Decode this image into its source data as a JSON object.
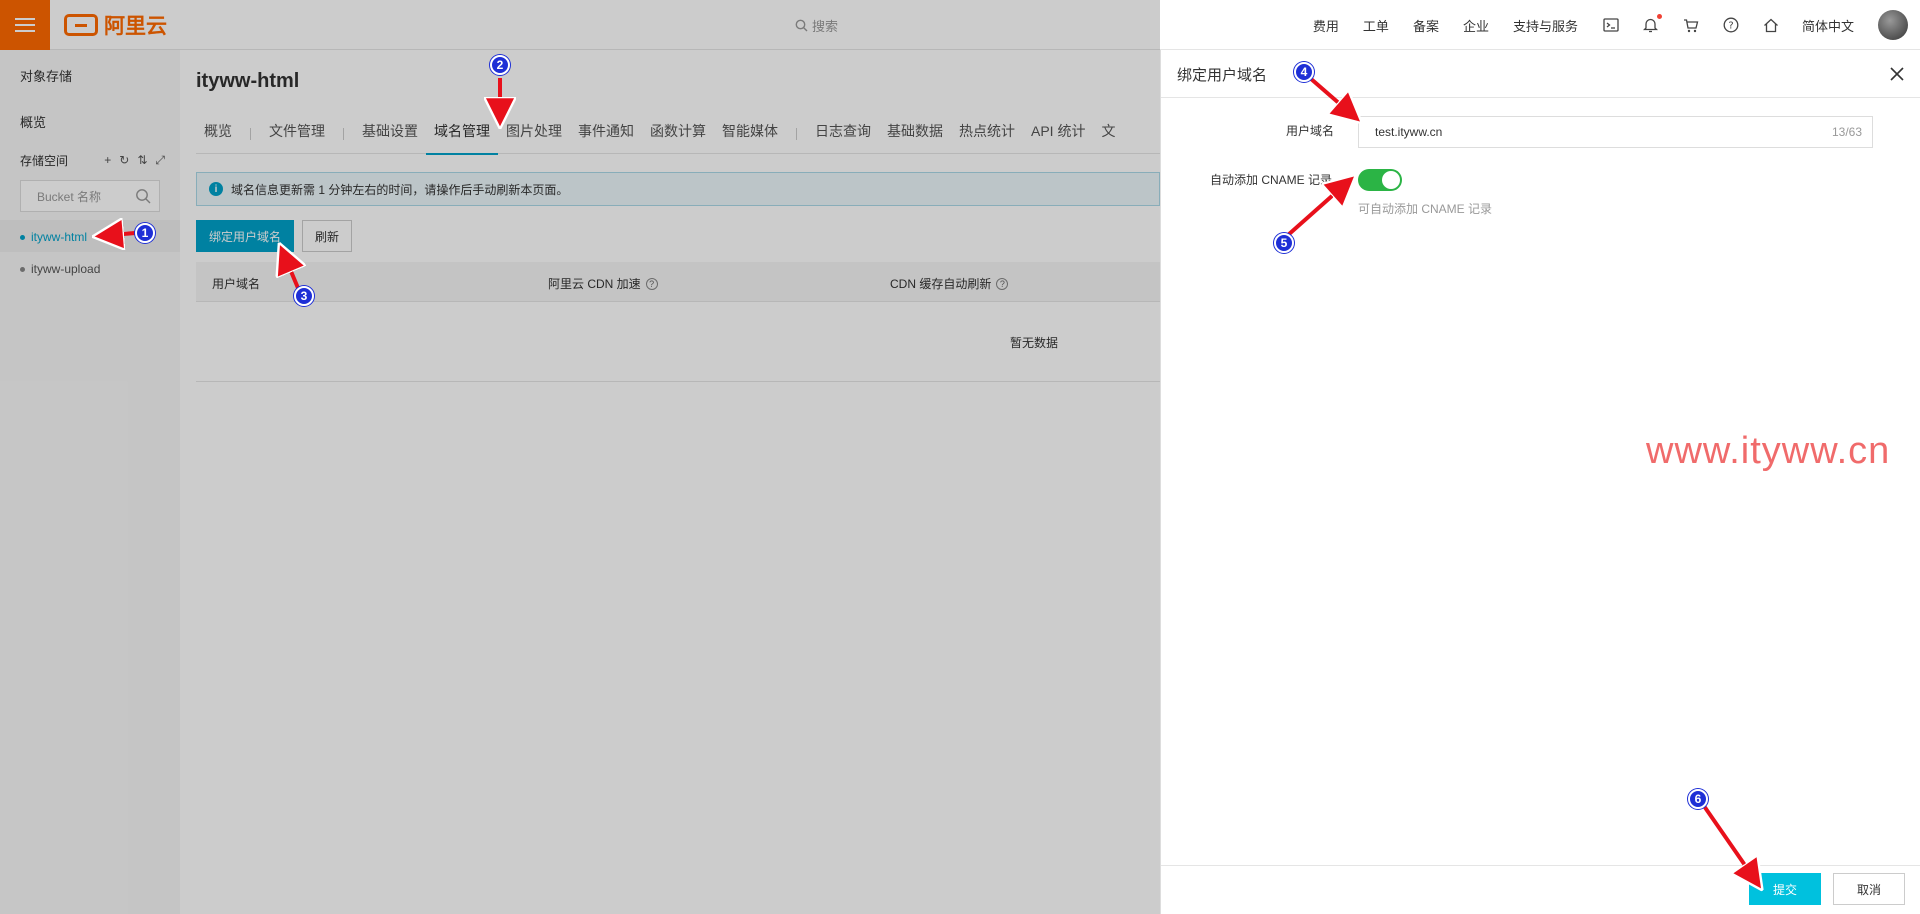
{
  "topbar": {
    "logo_text": "阿里云",
    "search_placeholder": "搜索",
    "nav": [
      "费用",
      "工单",
      "备案",
      "企业",
      "支持与服务"
    ],
    "language": "简体中文"
  },
  "sidebar": {
    "title": "对象存储",
    "overview": "概览",
    "space_header": "存储空间",
    "bucket_search_placeholder": "Bucket 名称",
    "buckets": [
      "ityww-html",
      "ityww-upload"
    ]
  },
  "main": {
    "page_title": "ityww-html",
    "tabs": [
      "概览",
      "文件管理",
      "基础设置",
      "域名管理",
      "图片处理",
      "事件通知",
      "函数计算",
      "智能媒体",
      "日志查询",
      "基础数据",
      "热点统计",
      "API 统计",
      "文"
    ],
    "active_tab": "域名管理",
    "notice": "域名信息更新需 1 分钟左右的时间，请操作后手动刷新本页面。",
    "bind_button": "绑定用户域名",
    "refresh_button": "刷新",
    "table_headers": [
      "用户域名",
      "阿里云 CDN 加速",
      "CDN 缓存自动刷新"
    ],
    "empty_text": "暂无数据"
  },
  "drawer": {
    "title": "绑定用户域名",
    "domain_label": "用户域名",
    "domain_value": "test.ityww.cn",
    "domain_count": "13/63",
    "cname_label": "自动添加 CNAME 记录",
    "cname_enabled": true,
    "cname_hint": "可自动添加 CNAME 记录",
    "submit_button": "提交",
    "cancel_button": "取消",
    "watermark": "www.ityww.cn"
  },
  "annotations": [
    "1",
    "2",
    "3",
    "4",
    "5",
    "6"
  ],
  "colors": {
    "brand": "#ff6a00",
    "primary": "#00a2ca",
    "switch_on": "#2bb445",
    "badge": "#1e2fd6",
    "arrow": "#e8101b"
  }
}
